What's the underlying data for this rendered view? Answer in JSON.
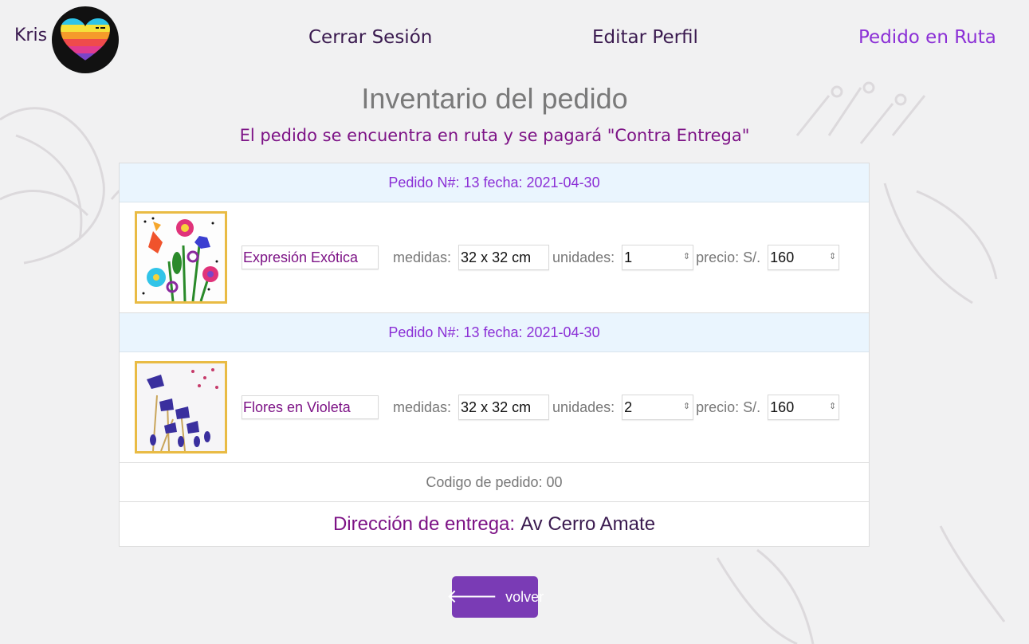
{
  "nav": {
    "brand": "Kris",
    "links": [
      "Cerrar Sesión",
      "Editar Perfil",
      "Pedido en Ruta"
    ]
  },
  "page": {
    "title": "Inventario del pedido",
    "subtitle": "El pedido se encuentra en ruta y se pagará \"Contra Entrega\""
  },
  "orders": [
    {
      "header": "Pedido N#: 13 fecha: 2021-04-30",
      "name": "Expresión Exótica",
      "medidas_label": "medidas:",
      "medidas": "32 x 32 cm",
      "unidades_label": "unidades:",
      "unidades": "1",
      "precio_label": "precio: S/.",
      "precio": "160",
      "image_icon": "colorful-flowers-painting"
    },
    {
      "header": "Pedido N#: 13 fecha: 2021-04-30",
      "name": "Flores en Violeta",
      "medidas_label": "medidas:",
      "medidas": "32 x 32 cm",
      "unidades_label": "unidades:",
      "unidades": "2",
      "precio_label": "precio: S/.",
      "precio": "160",
      "image_icon": "violet-flowers-painting"
    }
  ],
  "codigo": "Codigo de pedido: 00",
  "direccion": {
    "label": "Dirección de entrega:",
    "value": "Av Cerro Amate"
  },
  "button": {
    "label": "volver",
    "icon": "arrow-left-icon"
  },
  "colors": {
    "accent_purple": "#8b2fd6",
    "dark_purple": "#3a1a4f",
    "magenta": "#7d1386",
    "button": "#7a3bb5",
    "frame_gold": "#e9bb44"
  }
}
